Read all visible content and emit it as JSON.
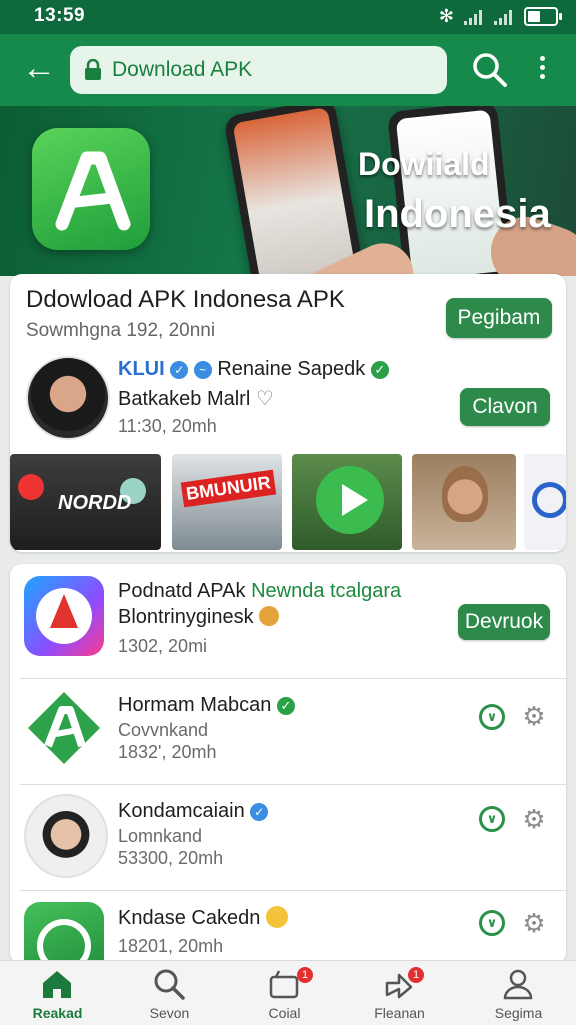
{
  "status_bar": {
    "time": "13:59"
  },
  "app_bar": {
    "url_text": "Download APK"
  },
  "banner": {
    "title_line1": "Dowiiald",
    "title_line2": "Indonesia"
  },
  "featured": {
    "title": "Ddowload APK Indonesa APK",
    "subtitle": "Sowmhgna  192, 20nni",
    "action_label": "Pegibam",
    "author": {
      "badge_text": "KLUI",
      "name": "Renaine Sapedk",
      "subtitle": "Batkakeb Malrl",
      "meta": "11:30, 20mh",
      "action_label": "Clavon"
    },
    "thumbnails": [
      {
        "caption": "NORDD"
      },
      {
        "caption": "BMUNUIR"
      },
      {
        "caption": ""
      },
      {
        "caption": ""
      },
      {
        "caption": ""
      }
    ]
  },
  "apps": [
    {
      "title": "Podnatd APAk",
      "title_extra": "Newnda tcalgara",
      "subtitle": "Blontrinyginesk",
      "meta": "1302, 20mi",
      "action_label": "Devruok"
    },
    {
      "title": "Hormam Mabcan",
      "subtitle": "Covvnkand",
      "meta": "1832', 20mh"
    },
    {
      "title": "Kondamcaiain",
      "subtitle": "Lomnkand",
      "meta": "53300, 20mh"
    },
    {
      "title": "Kndase Cakedn",
      "subtitle": "",
      "meta": "18201, 20mh"
    }
  ],
  "bottom_nav": [
    {
      "label": "Reakad",
      "active": true,
      "badge": ""
    },
    {
      "label": "Sevon",
      "active": false,
      "badge": ""
    },
    {
      "label": "Coial",
      "active": false,
      "badge": "1"
    },
    {
      "label": "Fleanan",
      "active": false,
      "badge": "1"
    },
    {
      "label": "Segima",
      "active": false,
      "badge": ""
    }
  ],
  "colors": {
    "primary": "#168a4a",
    "status_bar": "#0e6a3c",
    "button": "#2d8a4b",
    "badge": "#e23030"
  },
  "icons": [
    "back-arrow-icon",
    "lock-icon",
    "search-icon",
    "more-vert-icon",
    "verified-icon",
    "heart-icon",
    "download-icon",
    "gear-icon",
    "home-icon",
    "cart-icon",
    "share-icon",
    "profile-icon"
  ]
}
